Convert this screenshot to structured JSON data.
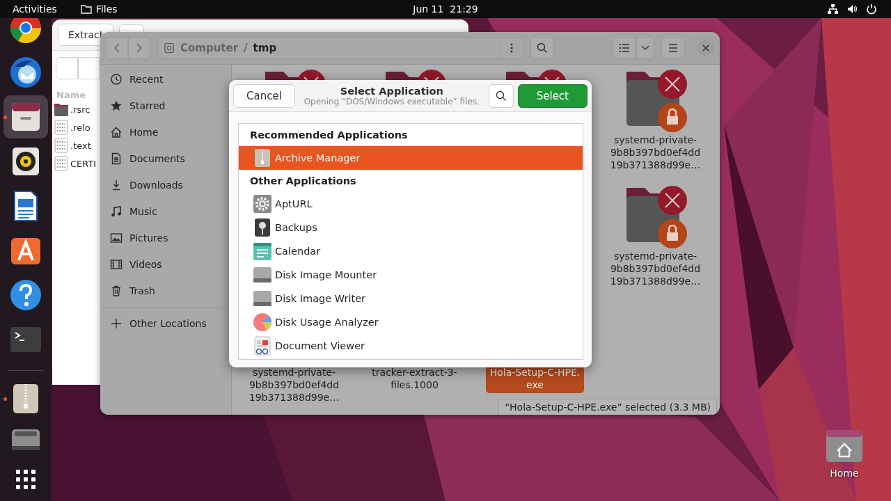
{
  "top_bar": {
    "activities": "Activities",
    "app_name": "Files",
    "clock": "Jun 11  21:29"
  },
  "dock": [
    {
      "running": false,
      "focused": false
    },
    {
      "running": false,
      "focused": false
    },
    {
      "running": true,
      "focused": true
    },
    {
      "running": false,
      "focused": false
    },
    {
      "running": false,
      "focused": false
    },
    {
      "running": false,
      "focused": false
    },
    {
      "running": false,
      "focused": false
    },
    {
      "running": false,
      "focused": false
    },
    {
      "running": true,
      "focused": false
    },
    {
      "running": false,
      "focused": false
    },
    {
      "running": false,
      "focused": false
    }
  ],
  "archive_window": {
    "extract_button": "Extract",
    "column_header": "Name",
    "rows": [
      {
        "name": ".rsrc",
        "kind": "folder"
      },
      {
        "name": ".relo",
        "kind": "binary"
      },
      {
        "name": ".text",
        "kind": "binary"
      },
      {
        "name": "CERTI",
        "kind": "binary"
      }
    ]
  },
  "files_window": {
    "path": [
      {
        "label": "Computer",
        "current": false
      },
      {
        "label": "tmp",
        "current": true
      }
    ],
    "path_separator": "/",
    "sidebar": [
      {
        "label": "Recent"
      },
      {
        "label": "Starred"
      },
      {
        "label": "Home"
      },
      {
        "label": "Documents"
      },
      {
        "label": "Downloads"
      },
      {
        "label": "Music"
      },
      {
        "label": "Pictures"
      },
      {
        "label": "Videos"
      },
      {
        "label": "Trash"
      }
    ],
    "other_locations": "Other Locations",
    "grid": [
      [
        {
          "kind": "locked-folder",
          "selected": false
        },
        {
          "kind": "locked-folder",
          "selected": false
        },
        {
          "kind": "locked-folder",
          "selected": false
        },
        {
          "kind": "locked-folder",
          "selected": false,
          "label": [
            "systemd-private-",
            "9b8b397bd0ef4dd",
            "19b371388d99e…"
          ]
        }
      ],
      [
        {
          "kind": "locked-folder",
          "selected": false,
          "label": [
            "systemd-private-",
            "9b8b397bd0ef4dd",
            "19b371388d99e…"
          ]
        }
      ],
      [
        {
          "selected": false,
          "label": [
            "systemd-private-",
            "9b8b397bd0ef4dd",
            "19b371388d99e…"
          ]
        },
        {
          "selected": false,
          "label": [
            "tracker-extract-3-",
            "files.1000"
          ]
        },
        {
          "selected": true,
          "label": [
            "Hola-Setup-C-HPE.",
            "exe"
          ]
        }
      ]
    ],
    "status": "“Hola-Setup-C-HPE.exe” selected (3.3 MB)"
  },
  "dialog": {
    "cancel": "Cancel",
    "title": "Select Application",
    "subtitle": "Opening “DOS/Windows executable” files.",
    "select": "Select",
    "sections": [
      {
        "heading": "Recommended Applications",
        "apps": [
          {
            "name": "Archive Manager",
            "selected": true
          }
        ]
      },
      {
        "heading": "Other Applications",
        "apps": [
          {
            "name": "AptURL",
            "selected": false
          },
          {
            "name": "Backups",
            "selected": false
          },
          {
            "name": "Calendar",
            "selected": false
          },
          {
            "name": "Disk Image Mounter",
            "selected": false
          },
          {
            "name": "Disk Image Writer",
            "selected": false
          },
          {
            "name": "Disk Usage Analyzer",
            "selected": false
          },
          {
            "name": "Document Viewer",
            "selected": false
          }
        ]
      }
    ]
  },
  "desktop_icons": [
    {
      "label": "Home"
    }
  ]
}
